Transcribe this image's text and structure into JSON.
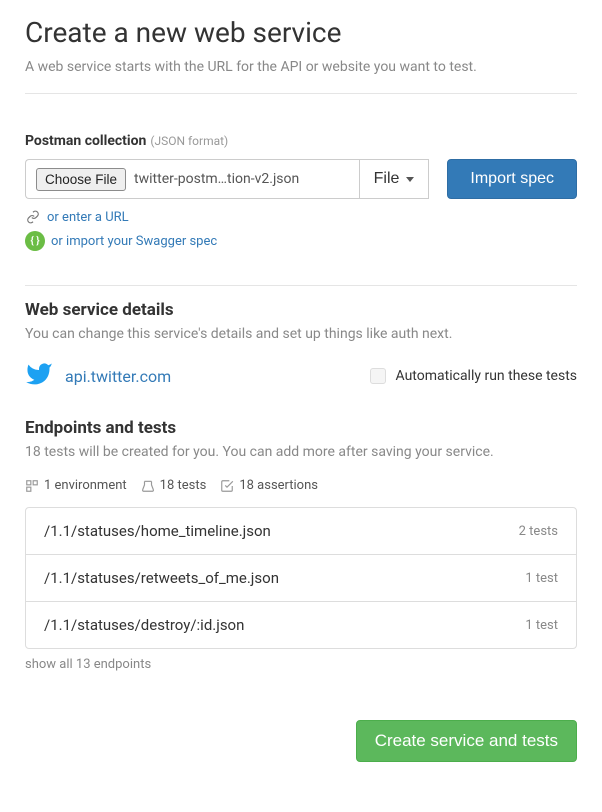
{
  "header": {
    "title": "Create a new web service",
    "subtitle": "A web service starts with the URL for the API or website you want to test."
  },
  "postman": {
    "label": "Postman collection",
    "hint": "(JSON format)",
    "choose_file_label": "Choose File",
    "filename": "twitter-postm…tion-v2.json",
    "file_type_label": "File",
    "import_label": "Import spec",
    "enter_url_label": "or enter a URL",
    "swagger_label": "or import your Swagger spec"
  },
  "details": {
    "title": "Web service details",
    "desc": "You can change this service's details and set up things like auth next.",
    "service_url": "api.twitter.com",
    "auto_run_label": "Automatically run these tests"
  },
  "endpoints": {
    "title": "Endpoints and tests",
    "desc": "18 tests will be created for you. You can add more after saving your service.",
    "stats": {
      "environments": "1 environment",
      "tests": "18 tests",
      "assertions": "18 assertions"
    },
    "items": [
      {
        "path": "/1.1/statuses/home_timeline.json",
        "tests": "2 tests"
      },
      {
        "path": "/1.1/statuses/retweets_of_me.json",
        "tests": "1 test"
      },
      {
        "path": "/1.1/statuses/destroy/:id.json",
        "tests": "1 test"
      }
    ],
    "show_all": "show all 13 endpoints"
  },
  "footer": {
    "create_label": "Create service and tests"
  }
}
